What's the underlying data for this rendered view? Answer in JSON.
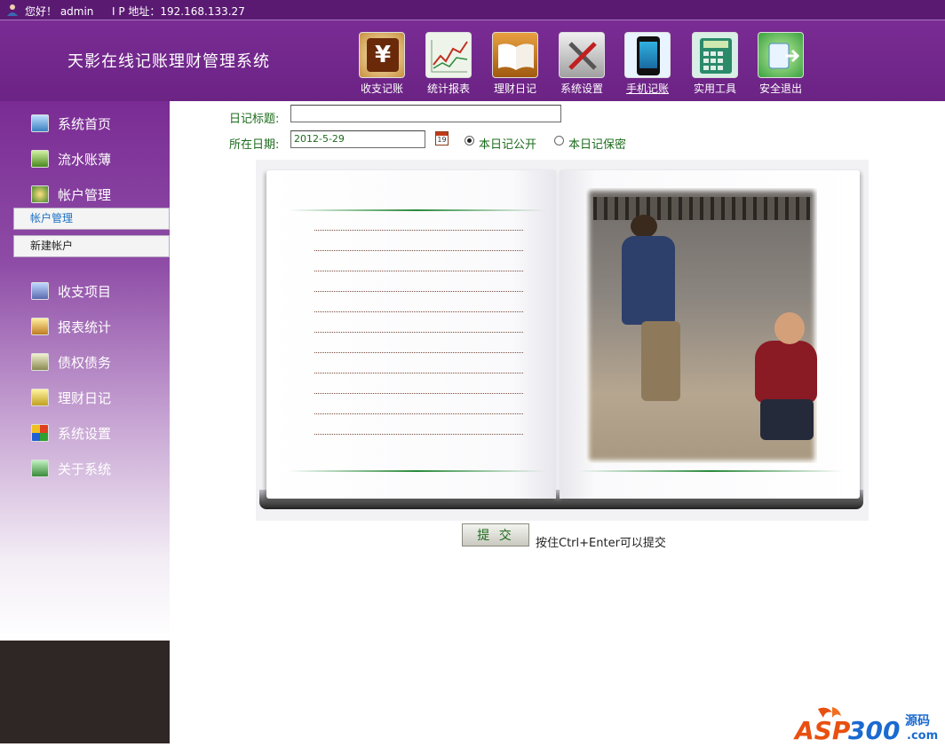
{
  "topbar": {
    "greeting": "您好！ admin",
    "ip_label": "I P 地址：192.168.133.27"
  },
  "header": {
    "title": "天影在线记账理财管理系统",
    "tools": [
      {
        "label": "收支记账",
        "icon": "yuan-ledger-icon",
        "color": "#7a3a12"
      },
      {
        "label": "统计报表",
        "icon": "chart-report-icon",
        "color": "#e8f0e4"
      },
      {
        "label": "理财日记",
        "icon": "open-book-icon",
        "color": "#c07a20"
      },
      {
        "label": "系统设置",
        "icon": "tools-icon",
        "color": "#d9d9d9"
      },
      {
        "label": "手机记账",
        "icon": "mobile-phone-icon",
        "color": "#101820"
      },
      {
        "label": "实用工具",
        "icon": "calculator-icon",
        "color": "#2a8a6a"
      },
      {
        "label": "安全退出",
        "icon": "exit-icon",
        "color": "#3aa040"
      }
    ]
  },
  "sidebar": {
    "items": [
      {
        "label": "系统首页",
        "icon": "home-icon"
      },
      {
        "label": "流水账薄",
        "icon": "ledger-icon"
      },
      {
        "label": "帐户管理",
        "icon": "account-icon"
      },
      {
        "label": "收支项目",
        "icon": "items-icon"
      },
      {
        "label": "报表统计",
        "icon": "stats-icon"
      },
      {
        "label": "债权债务",
        "icon": "debt-icon"
      },
      {
        "label": "理财日记",
        "icon": "diary-icon"
      },
      {
        "label": "系统设置",
        "icon": "windows-settings-icon"
      },
      {
        "label": "关于系统",
        "icon": "about-icon"
      }
    ],
    "subitems": [
      {
        "label": "帐户管理",
        "active": true
      },
      {
        "label": "新建帐户",
        "active": false
      }
    ]
  },
  "form": {
    "title_label": "日记标题:",
    "title_value": "",
    "date_label": "所在日期:",
    "date_value": "2012-5-29",
    "calendar_day": "19",
    "radio_public": "本日记公开",
    "radio_private": "本日记保密",
    "selected": "public",
    "submit_label": "提 交",
    "hint": "按住Ctrl+Enter可以提交"
  },
  "watermark": {
    "text": "ASP300",
    "cn": "源码",
    "suffix": ".com"
  },
  "colors": {
    "purple": "#6b2384",
    "green_label": "#1c6b1c",
    "dark": "#2f2626"
  }
}
